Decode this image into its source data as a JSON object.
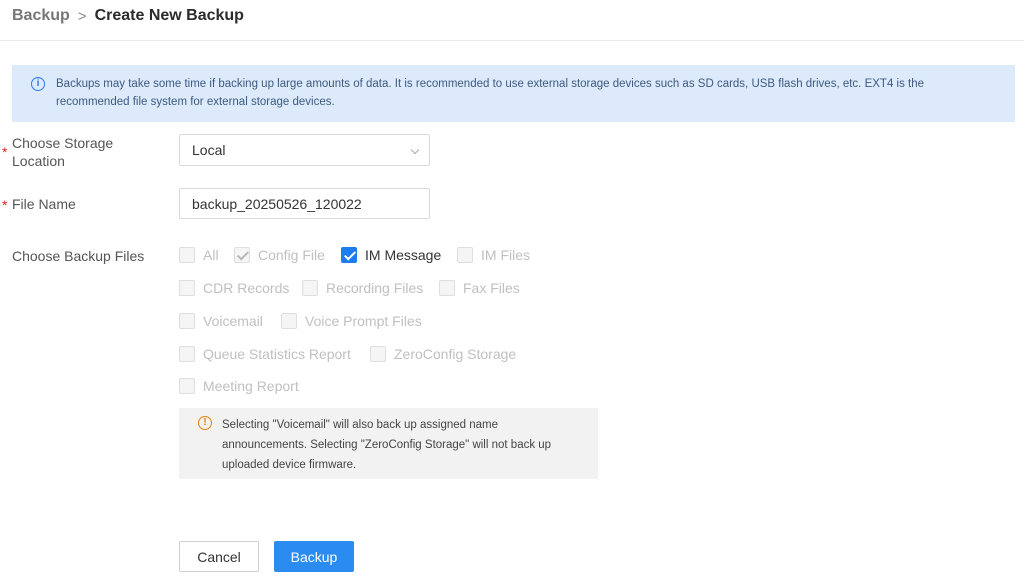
{
  "breadcrumb": {
    "parent": "Backup",
    "separator": ">",
    "current": "Create New Backup"
  },
  "notice": {
    "icon": "info-icon",
    "text": "Backups may take some time if backing up large amounts of data. It is recommended to use external storage devices such as SD cards, USB flash drives, etc. EXT4 is the recommended file system for external storage devices."
  },
  "form": {
    "storage": {
      "required_mark": "*",
      "label_line1": "Choose Storage",
      "label_line2": "Location",
      "value": "Local"
    },
    "filename": {
      "required_mark": "*",
      "label": "File Name",
      "value": "backup_20250526_120022"
    },
    "backup_files": {
      "label": "Choose Backup Files",
      "options": [
        {
          "label": "All",
          "checked": false,
          "disabled": true
        },
        {
          "label": "Config File",
          "checked": true,
          "disabled": true
        },
        {
          "label": "IM Message",
          "checked": true,
          "disabled": false
        },
        {
          "label": "IM Files",
          "checked": false,
          "disabled": true
        },
        {
          "label": "CDR Records",
          "checked": false,
          "disabled": true
        },
        {
          "label": "Recording Files",
          "checked": false,
          "disabled": true
        },
        {
          "label": "Fax Files",
          "checked": false,
          "disabled": true
        },
        {
          "label": "Voicemail",
          "checked": false,
          "disabled": true
        },
        {
          "label": "Voice Prompt Files",
          "checked": false,
          "disabled": true
        },
        {
          "label": "Queue Statistics Report",
          "checked": false,
          "disabled": true
        },
        {
          "label": "ZeroConfig Storage",
          "checked": false,
          "disabled": true
        },
        {
          "label": "Meeting Report",
          "checked": false,
          "disabled": true
        }
      ]
    },
    "warning": {
      "icon": "warning-icon",
      "text": "Selecting \"Voicemail\" will also back up assigned name announcements. Selecting \"ZeroConfig Storage\" will not back up uploaded device firmware."
    }
  },
  "buttons": {
    "cancel": "Cancel",
    "backup": "Backup"
  },
  "colors": {
    "primary": "#2a8cf0",
    "notice_bg": "#dceafb",
    "warning_accent": "#e8820c",
    "required": "#e02020"
  }
}
